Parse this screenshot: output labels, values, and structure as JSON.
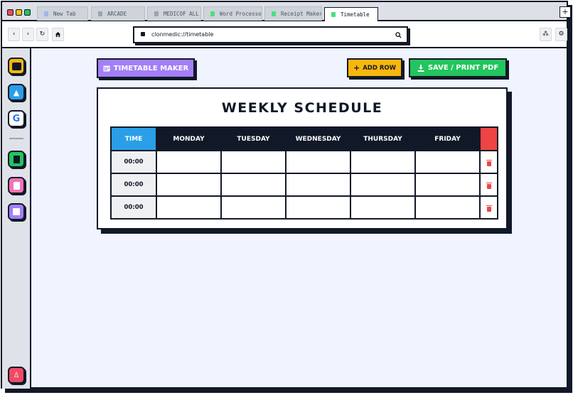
{
  "tabs": [
    {
      "label": "New Tab",
      "icon_color": "#9db5f2",
      "active": false
    },
    {
      "label": "ARCADE",
      "icon_color": "#9ca3af",
      "active": false
    },
    {
      "label": "MEDICOF ALL",
      "icon_color": "#9ca3af",
      "active": false
    },
    {
      "label": "Word Processor",
      "icon_color": "#4ade80",
      "active": false
    },
    {
      "label": "Receipt Maker",
      "icon_color": "#4ade80",
      "active": false
    },
    {
      "label": "Timetable",
      "icon_color": "#4ade80",
      "active": true
    }
  ],
  "newtab_label": "+",
  "address": {
    "url": "clonmedic://timetable"
  },
  "sidebar": {
    "items": [
      {
        "name": "game-app",
        "color": "#f7b70d"
      },
      {
        "name": "school-app",
        "color": "#2a9ee8"
      },
      {
        "name": "google-app",
        "color": "#ffffff",
        "glyph": "G"
      },
      {
        "name": "word-app",
        "color": "#22c55e"
      },
      {
        "name": "receipt-app",
        "color": "#f472b6"
      },
      {
        "name": "timetable-app",
        "color": "#a37ff7"
      }
    ],
    "bottom_item": {
      "name": "profile-app",
      "color": "#ef4a64"
    }
  },
  "toolbar": {
    "maker_label": "TIMETABLE MAKER",
    "add_row_label": "ADD ROW",
    "save_label": "SAVE / PRINT PDF"
  },
  "schedule": {
    "title": "WEEKLY SCHEDULE",
    "headers": [
      "TIME",
      "MONDAY",
      "TUESDAY",
      "WEDNESDAY",
      "THURSDAY",
      "FRIDAY"
    ],
    "rows": [
      {
        "time": "00:00",
        "cells": [
          "",
          "",
          "",
          "",
          ""
        ]
      },
      {
        "time": "00:00",
        "cells": [
          "",
          "",
          "",
          "",
          ""
        ]
      },
      {
        "time": "00:00",
        "cells": [
          "",
          "",
          "",
          "",
          ""
        ]
      }
    ]
  },
  "colors": {
    "accent_purple": "#a37ff7",
    "accent_yellow": "#f7b70d",
    "accent_green": "#22c55e",
    "time_header": "#2a9ee8",
    "delete_red": "#ef4444",
    "border": "#111827"
  }
}
